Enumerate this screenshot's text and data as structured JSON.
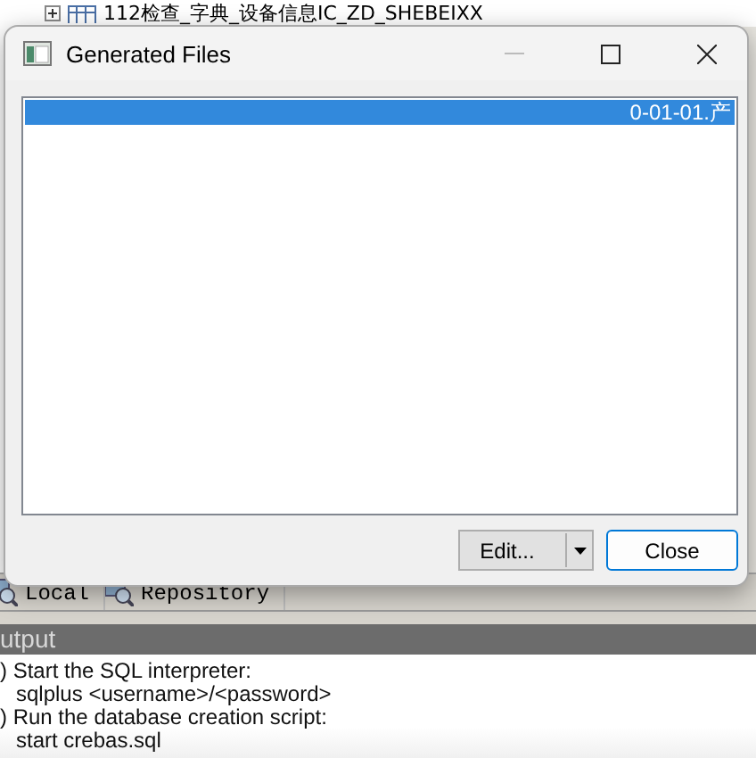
{
  "background_app": {
    "tree_item": "112检查_字典_设备信息IC_ZD_SHEBEIXX",
    "tabs": [
      {
        "label": "Local"
      },
      {
        "label": "Repository"
      }
    ],
    "output_panel": {
      "title": "utput",
      "lines": [
        {
          "kind": "step",
          "text": ") Start the SQL interpreter:"
        },
        {
          "kind": "command",
          "text": "sqlplus <username>/<password>"
        },
        {
          "kind": "step",
          "text": ") Run the database creation script:"
        },
        {
          "kind": "command",
          "text": "start crebas.sql"
        }
      ]
    }
  },
  "dialog": {
    "title": "Generated Files",
    "files": [
      {
        "name": "0-01-01.产",
        "selected": true
      }
    ],
    "buttons": [
      {
        "label": "Edit...",
        "kind": "split"
      },
      {
        "label": "Close",
        "kind": "default"
      }
    ]
  }
}
